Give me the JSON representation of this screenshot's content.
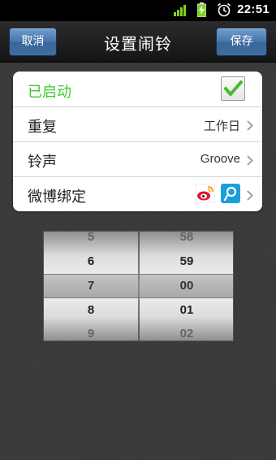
{
  "status_bar": {
    "time": "22:51",
    "icons": [
      "signal-bars-icon",
      "battery-charging-icon",
      "alarm-clock-icon"
    ]
  },
  "header": {
    "title": "设置闹铃",
    "cancel_label": "取消",
    "save_label": "保存",
    "button_color": "#4675a9"
  },
  "settings": {
    "enabled": {
      "label": "已启动",
      "checked": true,
      "label_color": "#3fc72d"
    },
    "repeat": {
      "label": "重复",
      "value": "工作日"
    },
    "ringtone": {
      "label": "铃声",
      "value": "Groove"
    },
    "weibo": {
      "label": "微博绑定",
      "icons": [
        "sina-weibo-icon",
        "tencent-weibo-icon"
      ]
    }
  },
  "time_picker": {
    "hours": [
      "5",
      "6",
      "7",
      "8",
      "9"
    ],
    "minutes": [
      "58",
      "59",
      "00",
      "01",
      "02"
    ],
    "selected_hour": "7",
    "selected_minute": "00"
  }
}
